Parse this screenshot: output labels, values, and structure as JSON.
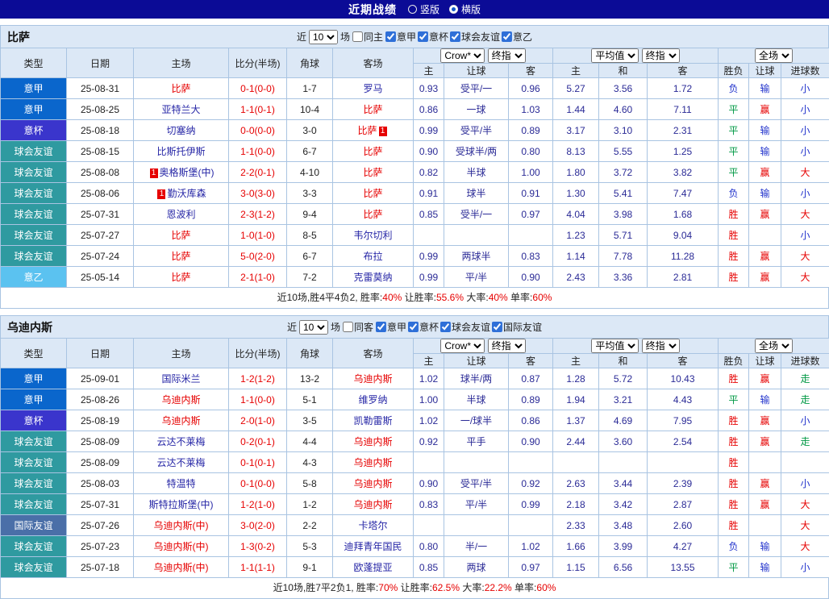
{
  "header": {
    "title": "近期战绩",
    "radio_vertical": "竖版",
    "radio_horizontal": "横版"
  },
  "type_colors": {
    "意甲": "#0a66cc",
    "意杯": "#3a35cc",
    "球会友谊": "#2f9aa0",
    "意乙": "#5bc2f0",
    "国际友谊": "#4a6fa8"
  },
  "sections": [
    {
      "team": "比萨",
      "filter": {
        "near_label": "近",
        "count": "10",
        "games_label": "场",
        "same_label": "同主",
        "leagues": [
          "意甲",
          "意杯",
          "球会友谊",
          "意乙"
        ]
      },
      "table": {
        "col_headers": [
          "类型",
          "日期",
          "主场",
          "比分(半场)",
          "角球",
          "客场"
        ],
        "odds_group": {
          "select1": "Crow*",
          "select2": "终指",
          "cols": [
            "主",
            "让球",
            "客"
          ]
        },
        "avg_group": {
          "select1": "平均值",
          "select2": "终指",
          "cols": [
            "主",
            "和",
            "客"
          ]
        },
        "result_group": {
          "select": "全场",
          "cols": [
            "胜负",
            "让球",
            "进球数"
          ]
        },
        "rows": [
          {
            "type": "意甲",
            "date": "25-08-31",
            "home": {
              "name": "比萨",
              "red": true
            },
            "score": "0-1(0-0)",
            "corner": "1-7",
            "away": {
              "name": "罗马",
              "red": false
            },
            "odds_home": "0.93",
            "handicap": "受平/一",
            "odds_away": "0.96",
            "avg_home": "5.27",
            "avg_draw": "3.56",
            "avg_away": "1.72",
            "result": "负",
            "result_color": "blue",
            "handicap_result": "输",
            "handicap_result_color": "blue",
            "goals": "小",
            "goals_color": "blue"
          },
          {
            "type": "意甲",
            "date": "25-08-25",
            "home": {
              "name": "亚特兰大",
              "red": false
            },
            "score": "1-1(0-1)",
            "corner": "10-4",
            "away": {
              "name": "比萨",
              "red": true
            },
            "odds_home": "0.86",
            "handicap": "一球",
            "odds_away": "1.03",
            "avg_home": "1.44",
            "avg_draw": "4.60",
            "avg_away": "7.11",
            "result": "平",
            "result_color": "green",
            "handicap_result": "赢",
            "handicap_result_color": "red",
            "goals": "小",
            "goals_color": "blue"
          },
          {
            "type": "意杯",
            "date": "25-08-18",
            "home": {
              "name": "切塞纳",
              "red": false
            },
            "score": "0-0(0-0)",
            "corner": "3-0",
            "away": {
              "name": "比萨",
              "red": true,
              "badge_after": "1"
            },
            "odds_home": "0.99",
            "handicap": "受平/半",
            "odds_away": "0.89",
            "avg_home": "3.17",
            "avg_draw": "3.10",
            "avg_away": "2.31",
            "result": "平",
            "result_color": "green",
            "handicap_result": "输",
            "handicap_result_color": "blue",
            "goals": "小",
            "goals_color": "blue"
          },
          {
            "type": "球会友谊",
            "date": "25-08-15",
            "home": {
              "name": "比斯托伊斯",
              "red": false
            },
            "score": "1-1(0-0)",
            "corner": "6-7",
            "away": {
              "name": "比萨",
              "red": true
            },
            "odds_home": "0.90",
            "handicap": "受球半/两",
            "odds_away": "0.80",
            "avg_home": "8.13",
            "avg_draw": "5.55",
            "avg_away": "1.25",
            "result": "平",
            "result_color": "green",
            "handicap_result": "输",
            "handicap_result_color": "blue",
            "goals": "小",
            "goals_color": "blue"
          },
          {
            "type": "球会友谊",
            "date": "25-08-08",
            "home": {
              "name": "奥格斯堡(中)",
              "red": false,
              "badge_before": "1"
            },
            "score": "2-2(0-1)",
            "corner": "4-10",
            "away": {
              "name": "比萨",
              "red": true
            },
            "odds_home": "0.82",
            "handicap": "半球",
            "odds_away": "1.00",
            "avg_home": "1.80",
            "avg_draw": "3.72",
            "avg_away": "3.82",
            "result": "平",
            "result_color": "green",
            "handicap_result": "赢",
            "handicap_result_color": "red",
            "goals": "大",
            "goals_color": "red"
          },
          {
            "type": "球会友谊",
            "date": "25-08-06",
            "home": {
              "name": "勤沃库森",
              "red": false,
              "badge_before": "1"
            },
            "score": "3-0(3-0)",
            "corner": "3-3",
            "away": {
              "name": "比萨",
              "red": true
            },
            "odds_home": "0.91",
            "handicap": "球半",
            "odds_away": "0.91",
            "avg_home": "1.30",
            "avg_draw": "5.41",
            "avg_away": "7.47",
            "result": "负",
            "result_color": "blue",
            "handicap_result": "输",
            "handicap_result_color": "blue",
            "goals": "小",
            "goals_color": "blue"
          },
          {
            "type": "球会友谊",
            "date": "25-07-31",
            "home": {
              "name": "恩波利",
              "red": false
            },
            "score": "2-3(1-2)",
            "corner": "9-4",
            "away": {
              "name": "比萨",
              "red": true
            },
            "odds_home": "0.85",
            "handicap": "受半/一",
            "odds_away": "0.97",
            "avg_home": "4.04",
            "avg_draw": "3.98",
            "avg_away": "1.68",
            "result": "胜",
            "result_color": "red",
            "handicap_result": "赢",
            "handicap_result_color": "red",
            "goals": "大",
            "goals_color": "red"
          },
          {
            "type": "球会友谊",
            "date": "25-07-27",
            "home": {
              "name": "比萨",
              "red": true
            },
            "score": "1-0(1-0)",
            "corner": "8-5",
            "away": {
              "name": "韦尔切利",
              "red": false
            },
            "odds_home": "",
            "handicap": "",
            "odds_away": "",
            "avg_home": "1.23",
            "avg_draw": "5.71",
            "avg_away": "9.04",
            "result": "胜",
            "result_color": "red",
            "handicap_result": "",
            "handicap_result_color": "",
            "goals": "小",
            "goals_color": "blue"
          },
          {
            "type": "球会友谊",
            "date": "25-07-24",
            "home": {
              "name": "比萨",
              "red": true
            },
            "score": "5-0(2-0)",
            "corner": "6-7",
            "away": {
              "name": "布拉",
              "red": false
            },
            "odds_home": "0.99",
            "handicap": "两球半",
            "odds_away": "0.83",
            "avg_home": "1.14",
            "avg_draw": "7.78",
            "avg_away": "11.28",
            "result": "胜",
            "result_color": "red",
            "handicap_result": "赢",
            "handicap_result_color": "red",
            "goals": "大",
            "goals_color": "red"
          },
          {
            "type": "意乙",
            "date": "25-05-14",
            "home": {
              "name": "比萨",
              "red": true
            },
            "score": "2-1(1-0)",
            "corner": "7-2",
            "away": {
              "name": "克雷莫纳",
              "red": false
            },
            "odds_home": "0.99",
            "handicap": "平/半",
            "odds_away": "0.90",
            "avg_home": "2.43",
            "avg_draw": "3.36",
            "avg_away": "2.81",
            "result": "胜",
            "result_color": "red",
            "handicap_result": "赢",
            "handicap_result_color": "red",
            "goals": "大",
            "goals_color": "red"
          }
        ]
      },
      "summary": [
        {
          "text": "近10场,胜4平4负2, 胜率:",
          "red": false
        },
        {
          "text": "40%",
          "red": true
        },
        {
          "text": " 让胜率:",
          "red": false
        },
        {
          "text": "55.6%",
          "red": true
        },
        {
          "text": " 大率:",
          "red": false
        },
        {
          "text": "40%",
          "red": true
        },
        {
          "text": " 单率:",
          "red": false
        },
        {
          "text": "60%",
          "red": true
        }
      ]
    },
    {
      "team": "乌迪内斯",
      "filter": {
        "near_label": "近",
        "count": "10",
        "games_label": "场",
        "same_label": "同客",
        "leagues": [
          "意甲",
          "意杯",
          "球会友谊",
          "国际友谊"
        ]
      },
      "table": {
        "col_headers": [
          "类型",
          "日期",
          "主场",
          "比分(半场)",
          "角球",
          "客场"
        ],
        "odds_group": {
          "select1": "Crow*",
          "select2": "终指",
          "cols": [
            "主",
            "让球",
            "客"
          ]
        },
        "avg_group": {
          "select1": "平均值",
          "select2": "终指",
          "cols": [
            "主",
            "和",
            "客"
          ]
        },
        "result_group": {
          "select": "全场",
          "cols": [
            "胜负",
            "让球",
            "进球数"
          ]
        },
        "rows": [
          {
            "type": "意甲",
            "date": "25-09-01",
            "home": {
              "name": "国际米兰",
              "red": false
            },
            "score": "1-2(1-2)",
            "corner": "13-2",
            "away": {
              "name": "乌迪内斯",
              "red": true
            },
            "odds_home": "1.02",
            "handicap": "球半/两",
            "odds_away": "0.87",
            "avg_home": "1.28",
            "avg_draw": "5.72",
            "avg_away": "10.43",
            "result": "胜",
            "result_color": "red",
            "handicap_result": "赢",
            "handicap_result_color": "red",
            "goals": "走",
            "goals_color": "green"
          },
          {
            "type": "意甲",
            "date": "25-08-26",
            "home": {
              "name": "乌迪内斯",
              "red": true
            },
            "score": "1-1(0-0)",
            "corner": "5-1",
            "away": {
              "name": "维罗纳",
              "red": false
            },
            "odds_home": "1.00",
            "handicap": "半球",
            "odds_away": "0.89",
            "avg_home": "1.94",
            "avg_draw": "3.21",
            "avg_away": "4.43",
            "result": "平",
            "result_color": "green",
            "handicap_result": "输",
            "handicap_result_color": "blue",
            "goals": "走",
            "goals_color": "green"
          },
          {
            "type": "意杯",
            "date": "25-08-19",
            "home": {
              "name": "乌迪内斯",
              "red": true
            },
            "score": "2-0(1-0)",
            "corner": "3-5",
            "away": {
              "name": "凯勒雷斯",
              "red": false
            },
            "odds_home": "1.02",
            "handicap": "一/球半",
            "odds_away": "0.86",
            "avg_home": "1.37",
            "avg_draw": "4.69",
            "avg_away": "7.95",
            "result": "胜",
            "result_color": "red",
            "handicap_result": "赢",
            "handicap_result_color": "red",
            "goals": "小",
            "goals_color": "blue"
          },
          {
            "type": "球会友谊",
            "date": "25-08-09",
            "home": {
              "name": "云达不莱梅",
              "red": false
            },
            "score": "0-2(0-1)",
            "corner": "4-4",
            "away": {
              "name": "乌迪内斯",
              "red": true
            },
            "odds_home": "0.92",
            "handicap": "平手",
            "odds_away": "0.90",
            "avg_home": "2.44",
            "avg_draw": "3.60",
            "avg_away": "2.54",
            "result": "胜",
            "result_color": "red",
            "handicap_result": "赢",
            "handicap_result_color": "red",
            "goals": "走",
            "goals_color": "green"
          },
          {
            "type": "球会友谊",
            "date": "25-08-09",
            "home": {
              "name": "云达不莱梅",
              "red": false
            },
            "score": "0-1(0-1)",
            "corner": "4-3",
            "away": {
              "name": "乌迪内斯",
              "red": true
            },
            "odds_home": "",
            "handicap": "",
            "odds_away": "",
            "avg_home": "",
            "avg_draw": "",
            "avg_away": "",
            "result": "胜",
            "result_color": "red",
            "handicap_result": "",
            "handicap_result_color": "",
            "goals": "",
            "goals_color": ""
          },
          {
            "type": "球会友谊",
            "date": "25-08-03",
            "home": {
              "name": "特温特",
              "red": false
            },
            "score": "0-1(0-0)",
            "corner": "5-8",
            "away": {
              "name": "乌迪内斯",
              "red": true
            },
            "odds_home": "0.90",
            "handicap": "受平/半",
            "odds_away": "0.92",
            "avg_home": "2.63",
            "avg_draw": "3.44",
            "avg_away": "2.39",
            "result": "胜",
            "result_color": "red",
            "handicap_result": "赢",
            "handicap_result_color": "red",
            "goals": "小",
            "goals_color": "blue"
          },
          {
            "type": "球会友谊",
            "date": "25-07-31",
            "home": {
              "name": "斯特拉斯堡(中)",
              "red": false
            },
            "score": "1-2(1-0)",
            "corner": "1-2",
            "away": {
              "name": "乌迪内斯",
              "red": true
            },
            "odds_home": "0.83",
            "handicap": "平/半",
            "odds_away": "0.99",
            "avg_home": "2.18",
            "avg_draw": "3.42",
            "avg_away": "2.87",
            "result": "胜",
            "result_color": "red",
            "handicap_result": "赢",
            "handicap_result_color": "red",
            "goals": "大",
            "goals_color": "red"
          },
          {
            "type": "国际友谊",
            "date": "25-07-26",
            "home": {
              "name": "乌迪内斯(中)",
              "red": true
            },
            "score": "3-0(2-0)",
            "corner": "2-2",
            "away": {
              "name": "卡塔尔",
              "red": false
            },
            "odds_home": "",
            "handicap": "",
            "odds_away": "",
            "avg_home": "2.33",
            "avg_draw": "3.48",
            "avg_away": "2.60",
            "result": "胜",
            "result_color": "red",
            "handicap_result": "",
            "handicap_result_color": "",
            "goals": "大",
            "goals_color": "red"
          },
          {
            "type": "球会友谊",
            "date": "25-07-23",
            "home": {
              "name": "乌迪内斯(中)",
              "red": true
            },
            "score": "1-3(0-2)",
            "corner": "5-3",
            "away": {
              "name": "迪拜青年国民",
              "red": false
            },
            "odds_home": "0.80",
            "handicap": "半/一",
            "odds_away": "1.02",
            "avg_home": "1.66",
            "avg_draw": "3.99",
            "avg_away": "4.27",
            "result": "负",
            "result_color": "blue",
            "handicap_result": "输",
            "handicap_result_color": "blue",
            "goals": "大",
            "goals_color": "red"
          },
          {
            "type": "球会友谊",
            "date": "25-07-18",
            "home": {
              "name": "乌迪内斯(中)",
              "red": true
            },
            "score": "1-1(1-1)",
            "corner": "9-1",
            "away": {
              "name": "欧蓬提亚",
              "red": false
            },
            "odds_home": "0.85",
            "handicap": "两球",
            "odds_away": "0.97",
            "avg_home": "1.15",
            "avg_draw": "6.56",
            "avg_away": "13.55",
            "result": "平",
            "result_color": "green",
            "handicap_result": "输",
            "handicap_result_color": "blue",
            "goals": "小",
            "goals_color": "blue"
          }
        ]
      },
      "summary": [
        {
          "text": "近10场,胜7平2负1, 胜率:",
          "red": false
        },
        {
          "text": "70%",
          "red": true
        },
        {
          "text": " 让胜率:",
          "red": false
        },
        {
          "text": "62.5%",
          "red": true
        },
        {
          "text": " 大率:",
          "red": false
        },
        {
          "text": "22.2%",
          "red": true
        },
        {
          "text": " 单率:",
          "red": false
        },
        {
          "text": "60%",
          "red": true
        }
      ]
    }
  ]
}
